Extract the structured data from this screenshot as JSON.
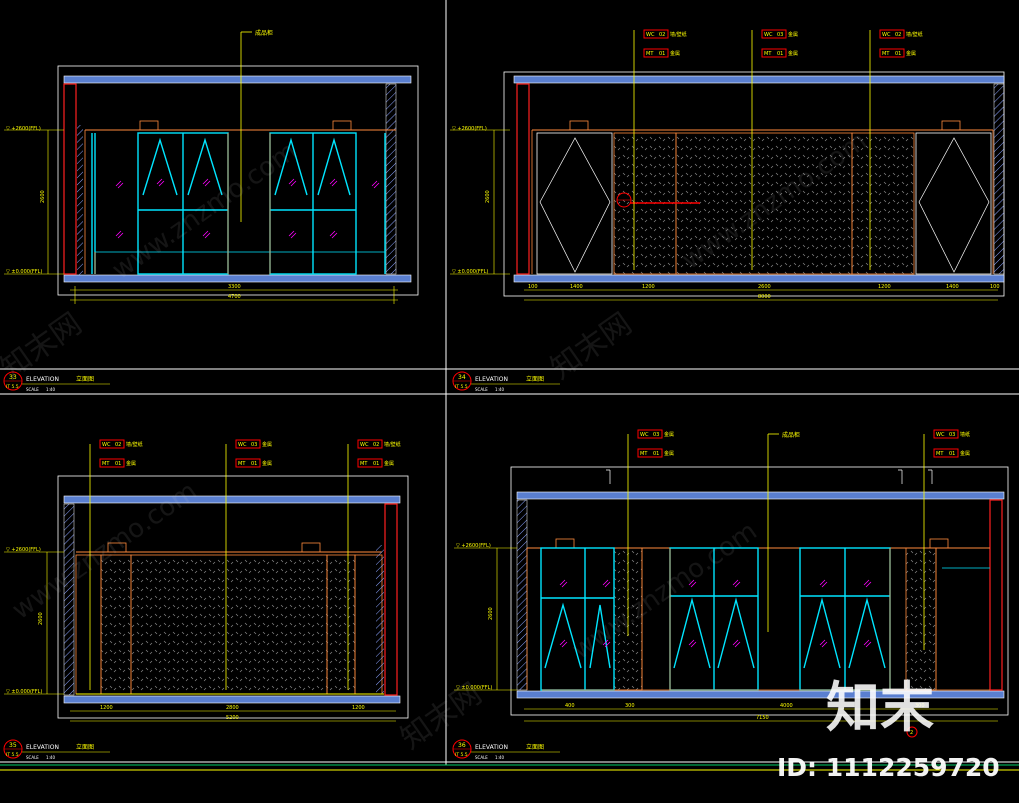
{
  "panels": [
    {
      "id": "33",
      "sheet": "IT 5.5",
      "title_en": "ELEVATION",
      "title_cn": "立面图",
      "scale_label": "SCALE",
      "scale_value": "1:40",
      "top_callout": "成品柜",
      "tags": [],
      "dims_bottom": [
        "3300"
      ],
      "total_dim": "4700",
      "level_top": "▽ +2600(FFL)",
      "level_bottom": "▽ ±0.000(FFL)",
      "height_dim": "2600"
    },
    {
      "id": "34",
      "sheet": "IT 5.5",
      "title_en": "ELEVATION",
      "title_cn": "立面图",
      "scale_label": "SCALE",
      "scale_value": "1:40",
      "top_callout": "",
      "tags": [
        {
          "code": "WC",
          "num": "02",
          "desc": "墙/壁纸"
        },
        {
          "code": "MT",
          "num": "01",
          "desc": "金属"
        },
        {
          "code": "WC",
          "num": "03",
          "desc": "金属"
        },
        {
          "code": "MT",
          "num": "01",
          "desc": "金属"
        },
        {
          "code": "WC",
          "num": "02",
          "desc": "墙/壁纸"
        },
        {
          "code": "MT",
          "num": "01",
          "desc": "金属"
        }
      ],
      "dims_bottom": [
        "100",
        "1400",
        "1200",
        "2600",
        "1200",
        "1400",
        "100"
      ],
      "total_dim": "8000",
      "level_top": "▽ +2600(FFL)",
      "level_bottom": "▽ ±0.000(FFL)",
      "height_dim": "2600",
      "callout_symbol": "1 / IT 5.5"
    },
    {
      "id": "35",
      "sheet": "IT 5.5",
      "title_en": "ELEVATION",
      "title_cn": "立面图",
      "scale_label": "SCALE",
      "scale_value": "1:40",
      "top_callout": "",
      "tags": [
        {
          "code": "WC",
          "num": "02",
          "desc": "墙/壁纸"
        },
        {
          "code": "MT",
          "num": "01",
          "desc": "金属"
        },
        {
          "code": "WC",
          "num": "03",
          "desc": "金属"
        },
        {
          "code": "MT",
          "num": "01",
          "desc": "金属"
        },
        {
          "code": "WC",
          "num": "02",
          "desc": "墙/壁纸"
        },
        {
          "code": "MT",
          "num": "01",
          "desc": "金属"
        }
      ],
      "dims_bottom": [
        "1200",
        "2800",
        "1200"
      ],
      "total_dim": "5200",
      "level_top": "▽ +2600(FFL)",
      "level_bottom": "▽ ±0.000(FFL)",
      "height_dim": "2600"
    },
    {
      "id": "36",
      "sheet": "IT 5.5",
      "title_en": "ELEVATION",
      "title_cn": "立面图",
      "scale_label": "SCALE",
      "scale_value": "1:40",
      "top_callout": "成品柜",
      "tags": [
        {
          "code": "WC",
          "num": "03",
          "desc": "金属"
        },
        {
          "code": "MT",
          "num": "01",
          "desc": "金属"
        },
        {
          "code": "WC",
          "num": "03",
          "desc": "墙纸"
        },
        {
          "code": "MT",
          "num": "01",
          "desc": "金属"
        }
      ],
      "dims_bottom": [
        "400",
        "300",
        "4000",
        "300"
      ],
      "total_dim": "7150",
      "level_top": "▽ +2600(FFL)",
      "level_bottom": "▽ ±0.000(FFL)",
      "height_dim": "2600",
      "callout_symbol": "2"
    }
  ],
  "watermark": {
    "brand_cn": "知末",
    "site_cn": "知末网",
    "url": "www.znzmo.com",
    "id_label": "ID: 1112259720"
  },
  "colors": {
    "background": "#000000",
    "frame": "#ffffff",
    "slab": "#5a7fd0",
    "glass": "#00e5ff",
    "cabinet": "#ff8a3c",
    "dimension": "#ffff00",
    "wall_hatch": "#8aa2ff",
    "column": "#ff2020",
    "tag": "#ff0000",
    "panel_pattern": "#7a7a7a",
    "purple_mark": "#ff00ff"
  }
}
